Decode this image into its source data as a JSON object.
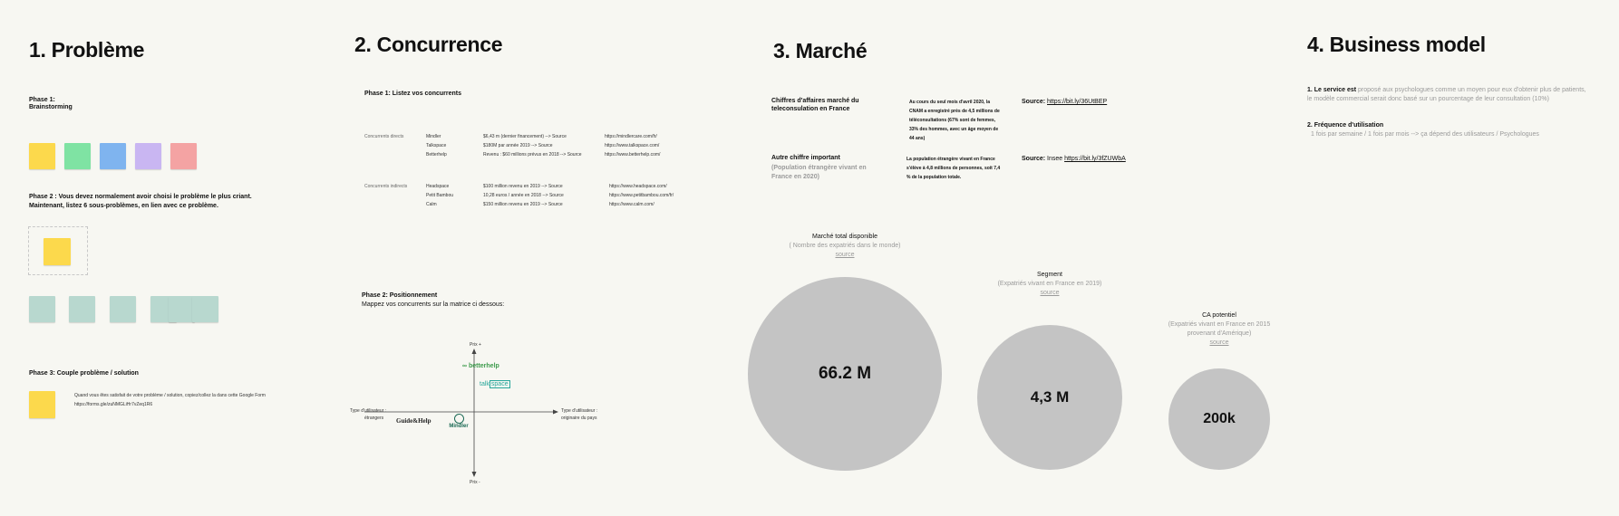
{
  "sections": {
    "probleme": {
      "title": "1. Problème",
      "phase1": "Phase 1:",
      "phase1_sub": "Brainstorming",
      "phase2_line1": "Phase 2 : Vous devez normalement avoir choisi le problème le plus criant.",
      "phase2_line2": "Maintenant, listez 6 sous-problèmes, en lien avec ce problème.",
      "phase3": "Phase 3: Couple problème / solution",
      "phase3_text": "Quand vous êtes satisfait de votre problème / solution, copiez/collez la dans cette Google Form",
      "phase3_link": "https://forms.gle/zuNMGLiHr7vZeq1R6"
    },
    "concurrence": {
      "title": "2. Concurrence",
      "phase1": "Phase 1: Listez vos concurrents",
      "direct_label": "Concurrents directs",
      "indirect_label": "Concurrents indirects",
      "direct": [
        {
          "name": "Mindler",
          "info": "$6,43 m (dernier financement) --> Source",
          "url": "https://mindlercare.com/fr/"
        },
        {
          "name": "Talkspace",
          "info": "$180M par année 2019 --> Source",
          "url": "https://www.talkspace.com/"
        },
        {
          "name": "Betterhelp",
          "info": "Revenu : $60 millions prévus en 2018 --> Source",
          "url": "https://www.betterhelp.com/"
        }
      ],
      "indirect": [
        {
          "name": "Headspace",
          "info": "$100 million revenu en 2019 --> Source",
          "url": "https://www.headspace.com/"
        },
        {
          "name": "Petit Bambou",
          "info": "10,28 euros / année en 2018 --> Source",
          "url": "https://www.petitbambou.com/fr/"
        },
        {
          "name": "Calm",
          "info": "$150 million revenu en 2019 --> Source",
          "url": "https://www.calm.com/"
        }
      ],
      "phase2": "Phase 2: Positionnement",
      "phase2_sub": "Mappez vos concurrents sur la matrice ci dessous:",
      "axis_top": "Prix +",
      "axis_bottom": "Prix -",
      "axis_left_1": "Type d'utilisateur :",
      "axis_left_2": "étrangers",
      "axis_right_1": "Type d'utilisateur :",
      "axis_right_2": "originaire du pays",
      "logo_betterhelp": "betterhelp",
      "logo_talkspace_1": "talk",
      "logo_talkspace_2": "space",
      "logo_guideandhelp": "Guide&Help",
      "logo_mindler": "Mindler"
    },
    "marche": {
      "title": "3. Marché",
      "ca_label_1": "Chiffres d'affaires marché du",
      "ca_label_2": "teleconsulation en France",
      "ca_text": "Au cours du seul mois d'avril 2020, la CNAM a enregistré près de 4,5 millions de téléconsultations (67% sont de femmes, 33% des hommes, avec un âge moyen de 44 ans)",
      "ca_source_label": "Source:",
      "ca_source_link": "https://bit.ly/36UtBEP",
      "autre_label": "Autre chiffre important",
      "autre_sub": "(Population étrangère vivant en France en 2020)",
      "autre_text": "La population étrangère vivant en France s'élève à 4,8 millions de personnes, soit 7,4 % de la population totale.",
      "autre_source_label": "Source:",
      "autre_source_pre": "Insee",
      "autre_source_link": "https://bit.ly/3fZUWbA",
      "tam_title": "Marché total disponible",
      "tam_sub": "( Nombre des expatriés dans le monde)",
      "tam_source": "source",
      "tam_value": "66.2 M",
      "seg_title": "Segment",
      "seg_sub": "(Expatriés vivant en France en 2019)",
      "seg_source": "source",
      "seg_value": "4,3 M",
      "ca_pot_title": "CA potentiel",
      "ca_pot_sub_1": "(Expatriés vivant en France en 2015",
      "ca_pot_sub_2": "provenant d'Amérique)",
      "ca_pot_source": "source",
      "ca_pot_value": "200k"
    },
    "business": {
      "title": "4. Business model",
      "item1_bold": "1. Le service est",
      "item1_text": " proposé aux psychologues comme un moyen pour eux d'obtenir plus de patients, le modèle commercial serait donc basé sur un pourcentage de leur consultation (10%)",
      "item2_bold": "2. Fréquence d'utilisation",
      "item2_text": "1 fois par semaine / 1 fois par mois --> ça dépend des utilisateurs / Psychologues"
    }
  },
  "colors": {
    "background": "#f7f7f2",
    "circle": "#c4c4c4",
    "note_yellow": "#fcd94c",
    "note_green": "#7fe3a3",
    "note_blue": "#7fb4ef",
    "note_purple": "#c9b6f2",
    "note_red": "#f4a3a3",
    "note_teal": "#b8d8cf",
    "betterhelp": "#3c9a4b",
    "talkspace": "#26a69a",
    "mindler": "#1c6a55"
  }
}
